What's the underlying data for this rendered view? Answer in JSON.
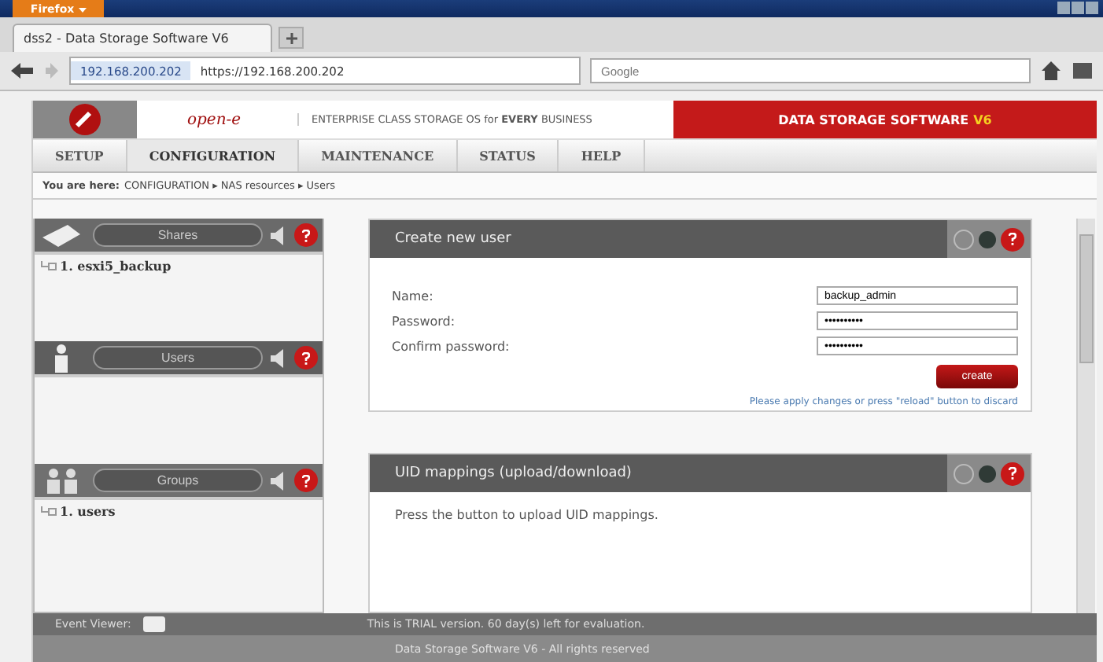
{
  "browser": {
    "menu_button": "Firefox",
    "tab_title": "dss2 - Data Storage Software V6",
    "url_host": "192.168.200.202",
    "url": "https://192.168.200.202",
    "search_placeholder": "Google"
  },
  "header": {
    "logo": "open-e",
    "tagline": "ENTERPRISE CLASS STORAGE OS for **EVERY** BUSINESS",
    "product": "DATA STORAGE SOFTWARE",
    "version": "V6"
  },
  "menu": [
    {
      "label": "SETUP",
      "selected": false
    },
    {
      "label": "CONFIGURATION",
      "selected": true
    },
    {
      "label": "MAINTENANCE",
      "selected": false
    },
    {
      "label": "STATUS",
      "selected": false
    },
    {
      "label": "HELP",
      "selected": false
    }
  ],
  "breadcrumb": {
    "prefix": "You are here:",
    "path": "CONFIGURATION ▸ NAS resources ▸ Users"
  },
  "sidebar": [
    {
      "kind": "shares",
      "title": "Shares",
      "items": [
        "1. esxi5_backup"
      ]
    },
    {
      "kind": "users",
      "title": "Users"
    },
    {
      "kind": "groups",
      "title": "Groups",
      "items": [
        "1. users"
      ]
    }
  ],
  "create_user": {
    "title": "Create new user",
    "fields": [
      {
        "label": "Name:",
        "value": "backup_admin"
      },
      {
        "label": "Password:",
        "value": "••••••••••"
      },
      {
        "label": "Confirm password:",
        "value": "••••••••••"
      }
    ],
    "button": "create",
    "note": "Please apply changes or press \"reload\" button to discard"
  },
  "uid_mappings": {
    "title": "UID mappings (upload/download)",
    "text": "Press the button to upload UID mappings."
  },
  "footer": {
    "event_viewer": "Event Viewer:",
    "trial": "This is TRIAL version. 60 day(s) left for evaluation.",
    "copyright": "Data Storage Software V6 - All rights reserved"
  }
}
